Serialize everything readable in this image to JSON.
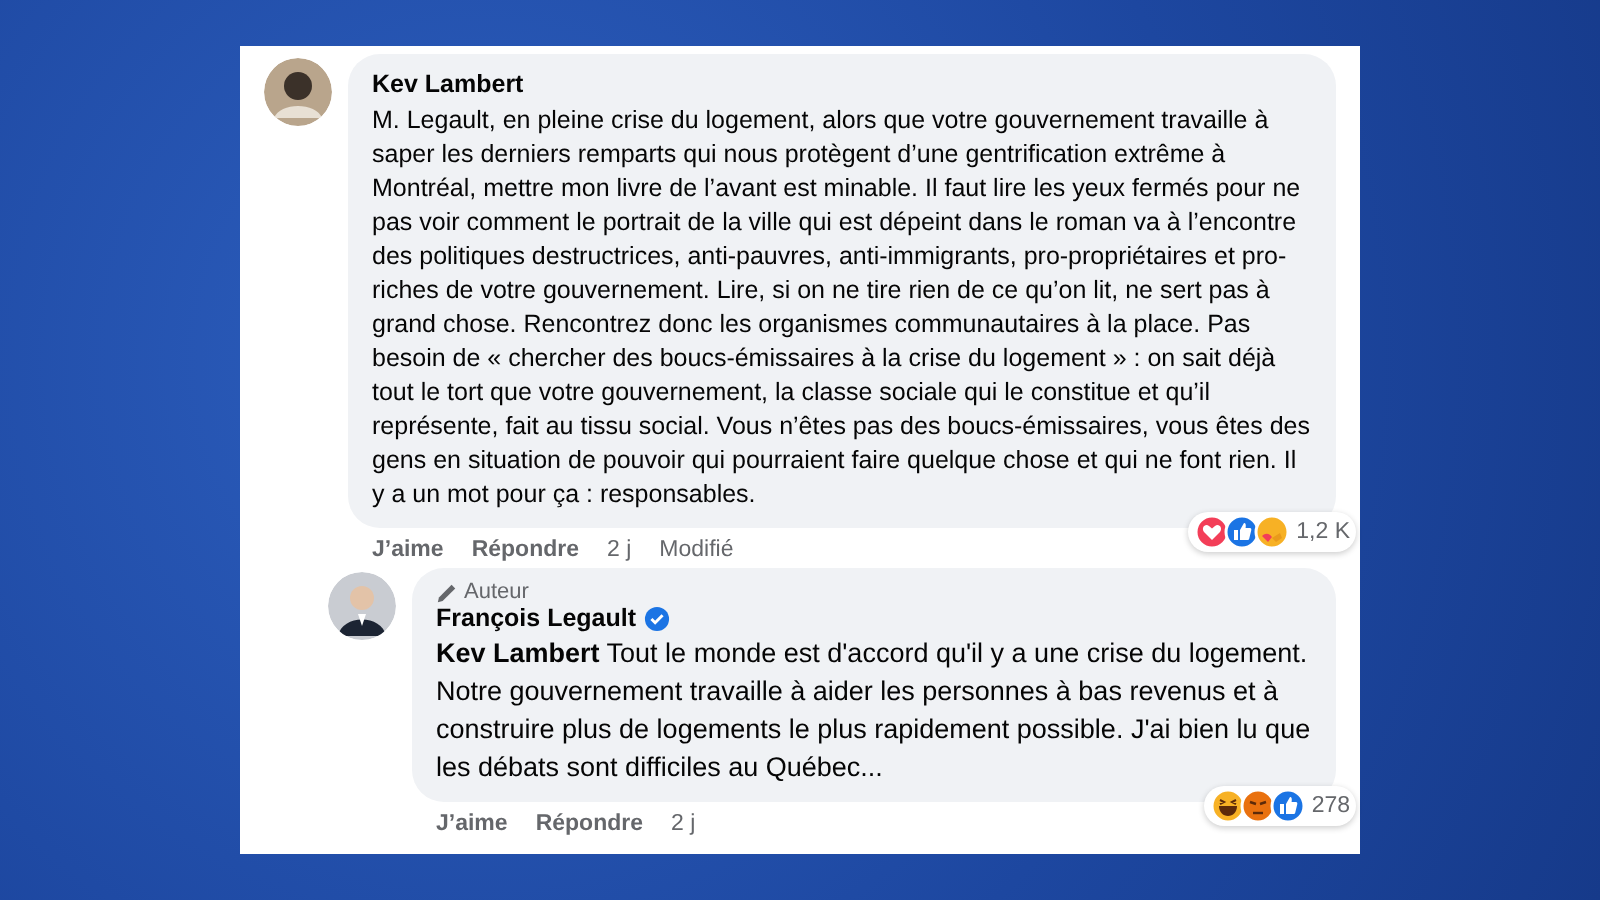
{
  "comments": [
    {
      "author": "Kev Lambert",
      "text": "M. Legault, en pleine crise du logement, alors que votre gouvernement travaille à saper les derniers remparts qui nous protègent d’une gentrification extrême à Montréal, mettre mon livre de l’avant est minable. Il faut lire les yeux fermés pour ne pas voir comment le portrait de la ville qui est dépeint dans le roman va à l’encontre des politiques destructrices, anti-pauvres, anti-immigrants, pro-propriétaires et pro-riches de votre gouvernement. Lire, si on ne tire rien de ce qu’on lit, ne sert pas à grand chose. Rencontrez donc les organismes communautaires à la place. Pas besoin de « chercher des boucs-émissaires à la crise du logement » : on sait déjà tout le tort que votre gouvernement, la classe sociale qui le constitue et qu’il représente, fait au tissu social. Vous n’êtes pas des boucs-émissaires, vous êtes des gens en situation de pouvoir qui pourraient faire quelque chose et qui ne font rien. Il y a un mot pour ça : responsables.",
      "actions": [
        "J’aime",
        "Répondre",
        "2 j",
        "Modifié"
      ],
      "reactions": [
        {
          "kind": "love"
        },
        {
          "kind": "like"
        },
        {
          "kind": "care"
        }
      ],
      "reaction_count": "1,2 K",
      "replies": [
        {
          "badge": "Auteur",
          "author": "François Legault",
          "verified": true,
          "text": "**Kev Lambert** Tout le monde est d'accord qu'il y a une crise du logement. Notre gouvernement travaille à aider les personnes à bas revenus et à construire plus de logements le plus rapidement possible. J'ai bien lu que les débats sont difficiles au Québec...",
          "actions": [
            "J’aime",
            "Répondre",
            "2 j"
          ],
          "reactions": [
            {
              "kind": "haha"
            },
            {
              "kind": "angry"
            },
            {
              "kind": "like"
            }
          ],
          "reaction_count": "278"
        }
      ]
    }
  ]
}
